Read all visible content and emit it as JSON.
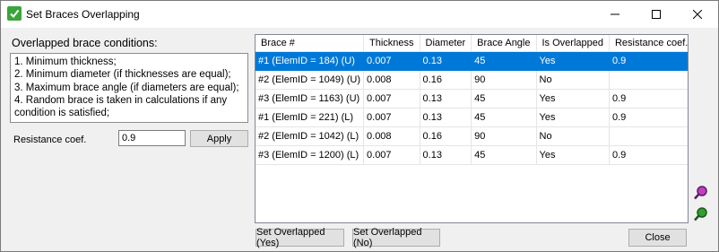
{
  "window": {
    "title": "Set Braces Overlapping"
  },
  "conditions": {
    "caption": "Overlapped brace conditions:",
    "lines": [
      "1. Minimum thickness;",
      "2. Minimum diameter (if thicknesses are equal);",
      "3. Maximum brace angle (if diameters are equal);",
      "4. Random brace is taken in calculations if any",
      "condition is satisfied;"
    ]
  },
  "resistance": {
    "label": "Resistance coef.",
    "value": "0.9",
    "apply_label": "Apply"
  },
  "table": {
    "columns": [
      "Brace #",
      "Thickness",
      "Diameter",
      "Brace Angle",
      "Is Overlapped",
      "Resistance coef."
    ],
    "rows": [
      [
        "#1 (ElemID = 184) (U)",
        "0.007",
        "0.13",
        "45",
        "Yes",
        "0.9"
      ],
      [
        "#2 (ElemID = 1049) (U)",
        "0.008",
        "0.16",
        "90",
        "No",
        ""
      ],
      [
        "#3 (ElemID = 1163) (U)",
        "0.007",
        "0.13",
        "45",
        "Yes",
        "0.9"
      ],
      [
        "#1 (ElemID = 221) (L)",
        "0.007",
        "0.13",
        "45",
        "Yes",
        "0.9"
      ],
      [
        "#2 (ElemID = 1042) (L)",
        "0.008",
        "0.16",
        "90",
        "No",
        ""
      ],
      [
        "#3 (ElemID = 1200) (L)",
        "0.007",
        "0.13",
        "45",
        "Yes",
        "0.9"
      ]
    ],
    "selected_row": 0
  },
  "buttons": {
    "set_yes": "Set Overlapped (Yes)",
    "set_no": "Set Overlapped (No)",
    "close": "Close"
  },
  "icons": {
    "title_icon": "check-icon",
    "zoom_in": "zoom-in-icon",
    "zoom_out": "zoom-out-icon"
  },
  "colors": {
    "selection": "#0078d7",
    "app_icon": "#3aa53a"
  }
}
